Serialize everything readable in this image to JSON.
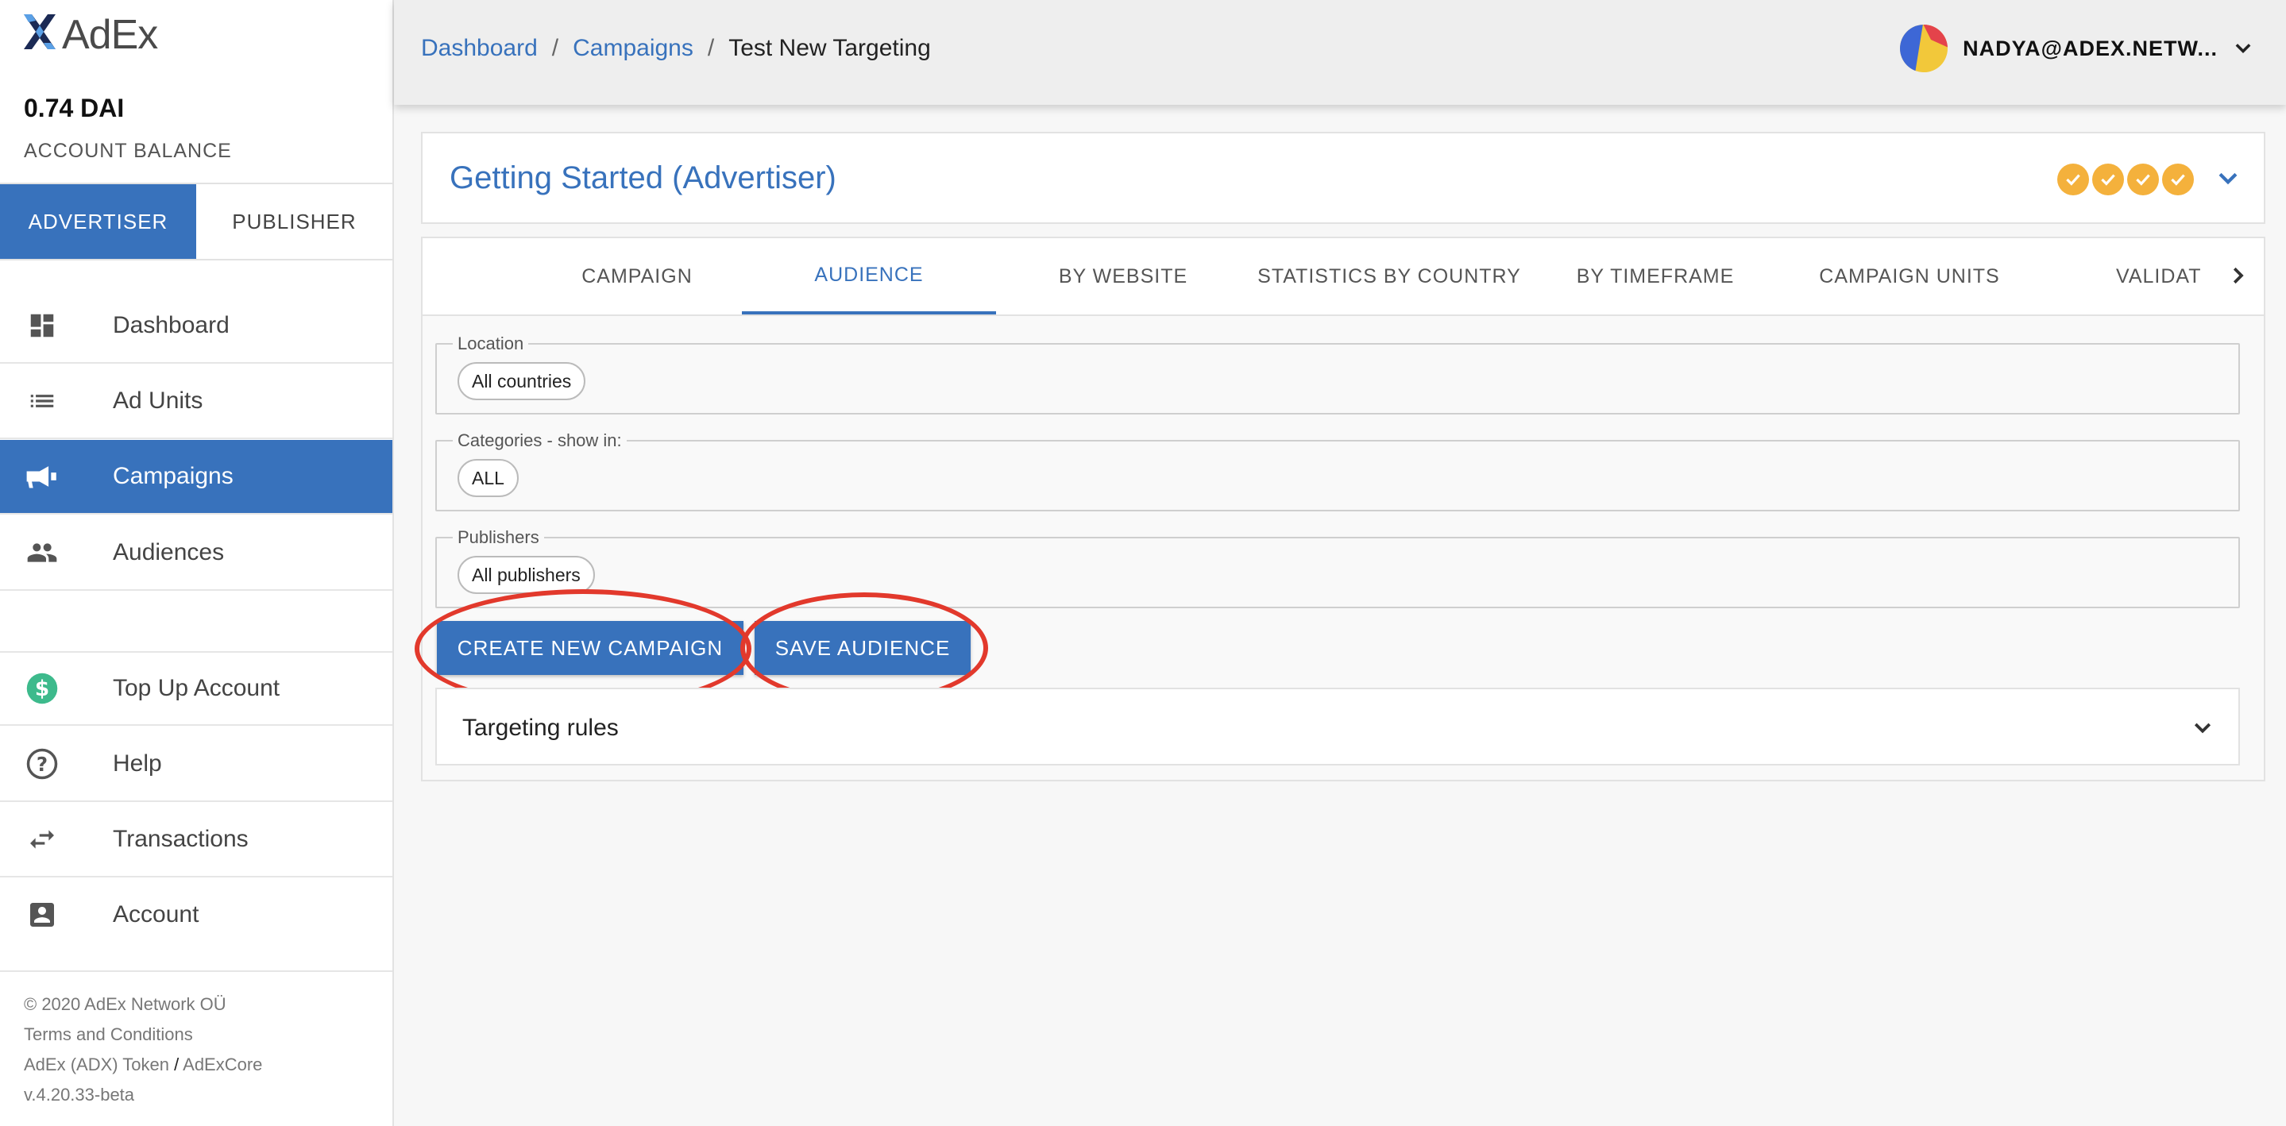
{
  "app": {
    "logo_text": "AdEx"
  },
  "account": {
    "balance": "0.74 DAI",
    "balance_label": "ACCOUNT BALANCE"
  },
  "roles": [
    {
      "label": "ADVERTISER",
      "active": true
    },
    {
      "label": "PUBLISHER",
      "active": false
    }
  ],
  "nav": [
    {
      "label": "Dashboard",
      "icon": "dashboard-icon"
    },
    {
      "label": "Ad Units",
      "icon": "list-icon"
    },
    {
      "label": "Campaigns",
      "icon": "megaphone-icon",
      "active": true
    },
    {
      "label": "Audiences",
      "icon": "people-icon"
    },
    {
      "label": "Top Up Account",
      "icon": "dollar-icon"
    },
    {
      "label": "Help",
      "icon": "help-icon"
    },
    {
      "label": "Transactions",
      "icon": "transfer-icon"
    },
    {
      "label": "Account",
      "icon": "account-icon"
    }
  ],
  "footer": {
    "copyright": "© 2020  AdEx Network OÜ",
    "terms": "Terms and Conditions",
    "token": "AdEx (ADX) Token",
    "sep": " / ",
    "core": "AdExCore",
    "version": "v.4.20.33-beta"
  },
  "breadcrumb": {
    "items": [
      "Dashboard",
      "Campaigns"
    ],
    "sep": "/",
    "current": "Test New Targeting"
  },
  "user": {
    "name": "NADYA@ADEX.NETW..."
  },
  "getting_started": {
    "title": "Getting Started (Advertiser)",
    "completed_steps": 4
  },
  "tabs": [
    {
      "label": "CAMPAIGN"
    },
    {
      "label": "AUDIENCE",
      "active": true
    },
    {
      "label": "BY WEBSITE"
    },
    {
      "label": "STATISTICS BY COUNTRY"
    },
    {
      "label": "BY TIMEFRAME"
    },
    {
      "label": "CAMPAIGN UNITS"
    },
    {
      "label": "VALIDAT"
    }
  ],
  "audience": {
    "location": {
      "legend": "Location",
      "chip": "All countries"
    },
    "categories": {
      "legend": "Categories - show in:",
      "chip": "ALL"
    },
    "publishers": {
      "legend": "Publishers",
      "chip": "All publishers"
    }
  },
  "buttons": {
    "create_campaign": "CREATE NEW CAMPAIGN",
    "save_audience": "SAVE AUDIENCE"
  },
  "targeting": {
    "label": "Targeting rules"
  },
  "colors": {
    "primary": "#3872bc",
    "annotation": "#e2392c",
    "check": "#f4b13c"
  }
}
